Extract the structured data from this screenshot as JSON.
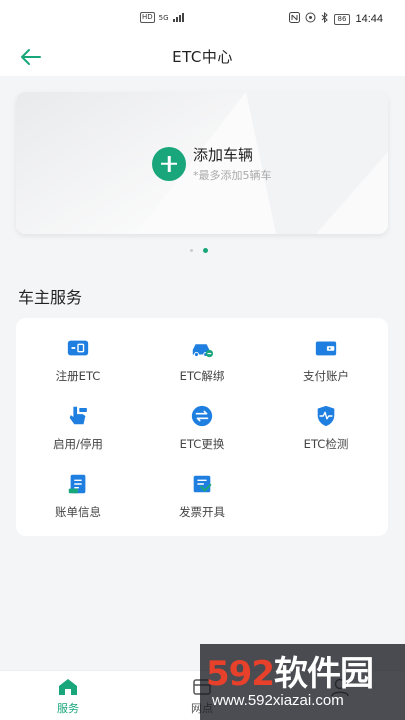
{
  "status_bar": {
    "sim_badge": "HD",
    "network": "5G",
    "battery": "86",
    "time": "14:44"
  },
  "header": {
    "title": "ETC中心",
    "back_icon": "arrow-left-icon"
  },
  "banner": {
    "add_title": "添加车辆",
    "add_subtitle": "*最多添加5辆车"
  },
  "carousel": {
    "page_count": 2,
    "active_index": 1
  },
  "services": {
    "section_title": "车主服务",
    "items": [
      {
        "label": "注册ETC",
        "icon": "etc-card-icon"
      },
      {
        "label": "ETC解绑",
        "icon": "car-unbind-icon"
      },
      {
        "label": "支付账户",
        "icon": "wallet-icon"
      },
      {
        "label": "启用/停用",
        "icon": "hand-toggle-icon"
      },
      {
        "label": "ETC更换",
        "icon": "swap-icon"
      },
      {
        "label": "ETC检测",
        "icon": "shield-pulse-icon"
      },
      {
        "label": "账单信息",
        "icon": "bill-icon"
      },
      {
        "label": "发票开具",
        "icon": "invoice-icon"
      }
    ]
  },
  "bottom_nav": {
    "items": [
      {
        "label": "服务",
        "icon": "home-icon",
        "active": true
      },
      {
        "label": "网点",
        "icon": "outlet-icon",
        "active": false
      },
      {
        "label": "",
        "icon": "user-icon",
        "active": false
      }
    ]
  },
  "watermark": {
    "number": "592",
    "text": "软件园",
    "url": "www.592xiazai.com"
  },
  "colors": {
    "accent": "#1aa67b",
    "icon_blue": "#1f7fe0",
    "background": "#f4f5f7"
  }
}
